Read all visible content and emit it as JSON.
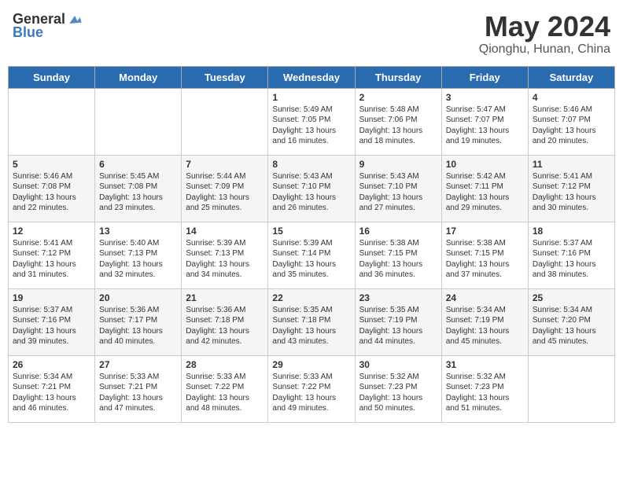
{
  "header": {
    "logo_general": "General",
    "logo_blue": "Blue",
    "month_title": "May 2024",
    "location": "Qionghu, Hunan, China"
  },
  "weekdays": [
    "Sunday",
    "Monday",
    "Tuesday",
    "Wednesday",
    "Thursday",
    "Friday",
    "Saturday"
  ],
  "weeks": [
    [
      {
        "day": "",
        "info": ""
      },
      {
        "day": "",
        "info": ""
      },
      {
        "day": "",
        "info": ""
      },
      {
        "day": "1",
        "info": "Sunrise: 5:49 AM\nSunset: 7:05 PM\nDaylight: 13 hours\nand 16 minutes."
      },
      {
        "day": "2",
        "info": "Sunrise: 5:48 AM\nSunset: 7:06 PM\nDaylight: 13 hours\nand 18 minutes."
      },
      {
        "day": "3",
        "info": "Sunrise: 5:47 AM\nSunset: 7:07 PM\nDaylight: 13 hours\nand 19 minutes."
      },
      {
        "day": "4",
        "info": "Sunrise: 5:46 AM\nSunset: 7:07 PM\nDaylight: 13 hours\nand 20 minutes."
      }
    ],
    [
      {
        "day": "5",
        "info": "Sunrise: 5:46 AM\nSunset: 7:08 PM\nDaylight: 13 hours\nand 22 minutes."
      },
      {
        "day": "6",
        "info": "Sunrise: 5:45 AM\nSunset: 7:08 PM\nDaylight: 13 hours\nand 23 minutes."
      },
      {
        "day": "7",
        "info": "Sunrise: 5:44 AM\nSunset: 7:09 PM\nDaylight: 13 hours\nand 25 minutes."
      },
      {
        "day": "8",
        "info": "Sunrise: 5:43 AM\nSunset: 7:10 PM\nDaylight: 13 hours\nand 26 minutes."
      },
      {
        "day": "9",
        "info": "Sunrise: 5:43 AM\nSunset: 7:10 PM\nDaylight: 13 hours\nand 27 minutes."
      },
      {
        "day": "10",
        "info": "Sunrise: 5:42 AM\nSunset: 7:11 PM\nDaylight: 13 hours\nand 29 minutes."
      },
      {
        "day": "11",
        "info": "Sunrise: 5:41 AM\nSunset: 7:12 PM\nDaylight: 13 hours\nand 30 minutes."
      }
    ],
    [
      {
        "day": "12",
        "info": "Sunrise: 5:41 AM\nSunset: 7:12 PM\nDaylight: 13 hours\nand 31 minutes."
      },
      {
        "day": "13",
        "info": "Sunrise: 5:40 AM\nSunset: 7:13 PM\nDaylight: 13 hours\nand 32 minutes."
      },
      {
        "day": "14",
        "info": "Sunrise: 5:39 AM\nSunset: 7:13 PM\nDaylight: 13 hours\nand 34 minutes."
      },
      {
        "day": "15",
        "info": "Sunrise: 5:39 AM\nSunset: 7:14 PM\nDaylight: 13 hours\nand 35 minutes."
      },
      {
        "day": "16",
        "info": "Sunrise: 5:38 AM\nSunset: 7:15 PM\nDaylight: 13 hours\nand 36 minutes."
      },
      {
        "day": "17",
        "info": "Sunrise: 5:38 AM\nSunset: 7:15 PM\nDaylight: 13 hours\nand 37 minutes."
      },
      {
        "day": "18",
        "info": "Sunrise: 5:37 AM\nSunset: 7:16 PM\nDaylight: 13 hours\nand 38 minutes."
      }
    ],
    [
      {
        "day": "19",
        "info": "Sunrise: 5:37 AM\nSunset: 7:16 PM\nDaylight: 13 hours\nand 39 minutes."
      },
      {
        "day": "20",
        "info": "Sunrise: 5:36 AM\nSunset: 7:17 PM\nDaylight: 13 hours\nand 40 minutes."
      },
      {
        "day": "21",
        "info": "Sunrise: 5:36 AM\nSunset: 7:18 PM\nDaylight: 13 hours\nand 42 minutes."
      },
      {
        "day": "22",
        "info": "Sunrise: 5:35 AM\nSunset: 7:18 PM\nDaylight: 13 hours\nand 43 minutes."
      },
      {
        "day": "23",
        "info": "Sunrise: 5:35 AM\nSunset: 7:19 PM\nDaylight: 13 hours\nand 44 minutes."
      },
      {
        "day": "24",
        "info": "Sunrise: 5:34 AM\nSunset: 7:19 PM\nDaylight: 13 hours\nand 45 minutes."
      },
      {
        "day": "25",
        "info": "Sunrise: 5:34 AM\nSunset: 7:20 PM\nDaylight: 13 hours\nand 45 minutes."
      }
    ],
    [
      {
        "day": "26",
        "info": "Sunrise: 5:34 AM\nSunset: 7:21 PM\nDaylight: 13 hours\nand 46 minutes."
      },
      {
        "day": "27",
        "info": "Sunrise: 5:33 AM\nSunset: 7:21 PM\nDaylight: 13 hours\nand 47 minutes."
      },
      {
        "day": "28",
        "info": "Sunrise: 5:33 AM\nSunset: 7:22 PM\nDaylight: 13 hours\nand 48 minutes."
      },
      {
        "day": "29",
        "info": "Sunrise: 5:33 AM\nSunset: 7:22 PM\nDaylight: 13 hours\nand 49 minutes."
      },
      {
        "day": "30",
        "info": "Sunrise: 5:32 AM\nSunset: 7:23 PM\nDaylight: 13 hours\nand 50 minutes."
      },
      {
        "day": "31",
        "info": "Sunrise: 5:32 AM\nSunset: 7:23 PM\nDaylight: 13 hours\nand 51 minutes."
      },
      {
        "day": "",
        "info": ""
      }
    ]
  ]
}
